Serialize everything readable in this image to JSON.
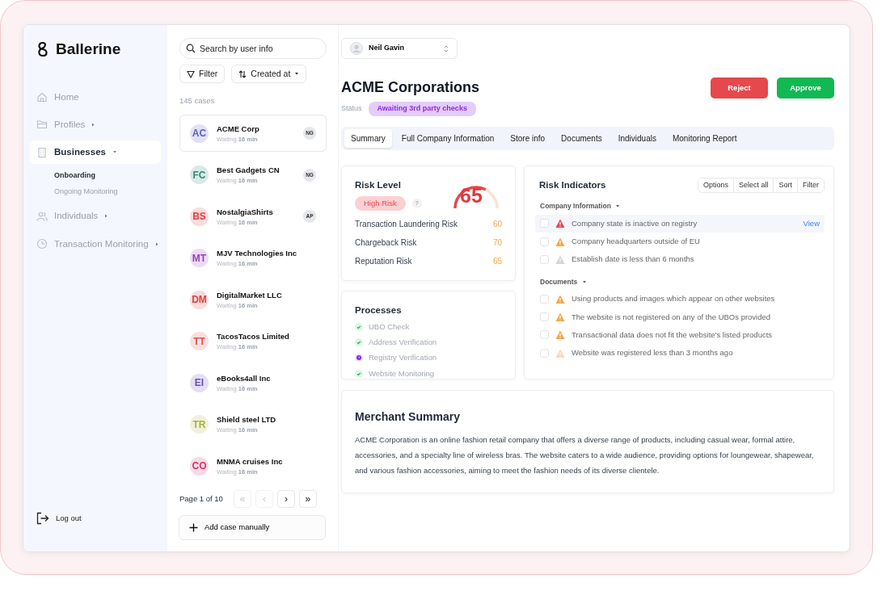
{
  "logo": {
    "text": "Ballerine"
  },
  "nav": [
    {
      "label": "Home",
      "kind": "link",
      "selected": false
    },
    {
      "label": "Profiles",
      "kind": "group",
      "selected": false,
      "expanded": false
    },
    {
      "label": "Businesses",
      "kind": "group",
      "selected": true,
      "expanded": true,
      "children": [
        {
          "label": "Onboarding",
          "selected": true
        },
        {
          "label": "Ongoing Monitoring",
          "selected": false
        }
      ]
    },
    {
      "label": "Individuals",
      "kind": "group",
      "selected": false,
      "expanded": false
    },
    {
      "label": "Transaction Monitoring",
      "kind": "group",
      "selected": false,
      "expanded": false
    }
  ],
  "logout": "Log out",
  "search": {
    "placeholder": "Search by user info"
  },
  "filter_button": "Filter",
  "sort_button": "Created at",
  "case_count": "145 cases",
  "cases": [
    {
      "initials": "AC",
      "color": "#5b5fc7",
      "name": "ACME Corp",
      "waiting": "Waiting",
      "time": "16 min",
      "assignee": "NG",
      "selected": true
    },
    {
      "initials": "FC",
      "color": "#2e8b72",
      "name": "Best Gadgets CN",
      "waiting": "Waiting",
      "time": "16 min",
      "assignee": "NG",
      "selected": false
    },
    {
      "initials": "BS",
      "color": "#e03e3e",
      "name": "NostalgiaShirts",
      "waiting": "Waiting",
      "time": "16 min",
      "assignee": "AP",
      "selected": false
    },
    {
      "initials": "MT",
      "color": "#9b3fc0",
      "name": "MJV Technologies Inc",
      "waiting": "Waiting",
      "time": "16 min",
      "selected": false
    },
    {
      "initials": "DM",
      "color": "#e03e3e",
      "name": "DigitalMarket LLC",
      "waiting": "Waiting",
      "time": "16 min",
      "selected": false
    },
    {
      "initials": "TT",
      "color": "#e05050",
      "name": "TacosTacos Limited",
      "waiting": "Waiting",
      "time": "16 min",
      "selected": false
    },
    {
      "initials": "EI",
      "color": "#6a4bc4",
      "name": "eBooks4all Inc",
      "waiting": "Waiting",
      "time": "16 min",
      "selected": false
    },
    {
      "initials": "TR",
      "color": "#a8b33a",
      "name": "Shield steel LTD",
      "waiting": "Waiting",
      "time": "16 min",
      "selected": false
    },
    {
      "initials": "CO",
      "color": "#d6336c",
      "name": "MNMA cruises Inc",
      "waiting": "Waiting",
      "time": "16 min",
      "selected": false
    }
  ],
  "pagination": {
    "label": "Page 1 of 10",
    "buttons": [
      {
        "label": "«",
        "disabled": true
      },
      {
        "label": "‹",
        "disabled": true
      },
      {
        "label": "›",
        "disabled": false
      },
      {
        "label": "»",
        "disabled": false
      }
    ]
  },
  "add_case": "Add case manually",
  "assignee": "Neil Gavin",
  "title": "ACME Corporations",
  "status_label": "Status",
  "status": "Awaiting 3rd party checks",
  "actions": [
    {
      "label": "Reject",
      "kind": "danger"
    },
    {
      "label": "Approve",
      "kind": "success"
    }
  ],
  "tabs": [
    {
      "label": "Summary",
      "selected": true
    },
    {
      "label": "Full Company Information",
      "selected": false
    },
    {
      "label": "Store info",
      "selected": false
    },
    {
      "label": "Documents",
      "selected": false
    },
    {
      "label": "Individuals",
      "selected": false
    },
    {
      "label": "Monitoring Report",
      "selected": false
    }
  ],
  "risk": {
    "title": "Risk Level",
    "badge": "High Risk",
    "help": "?",
    "score": "65",
    "rows": [
      {
        "label": "Transaction Laundering Risk",
        "value": "60"
      },
      {
        "label": "Chargeback Risk",
        "value": "70"
      },
      {
        "label": "Reputation Risk",
        "value": "65"
      }
    ]
  },
  "processes": {
    "title": "Processes",
    "items": [
      {
        "label": "UBO Check",
        "kind": "done"
      },
      {
        "label": "Address Verification",
        "kind": "done"
      },
      {
        "label": "Registry Verification",
        "kind": "pending"
      },
      {
        "label": "Website Monitoring",
        "kind": "done"
      }
    ]
  },
  "indicators": {
    "title": "Risk Indicators",
    "tools": [
      "Options",
      "Select all",
      "Sort",
      "Filter"
    ],
    "groups": [
      {
        "title": "Company Information",
        "expanded": true,
        "items": [
          {
            "text": "Company state is inactive on registry",
            "color": "#e5484d",
            "checked": false,
            "selected": true,
            "action": "View"
          },
          {
            "text": "Company headquarters outside of EU",
            "color": "#f5a54a",
            "checked": false,
            "selected": false
          },
          {
            "text": "Establish date is less than 6 months",
            "color": "#d4d4d8",
            "checked": false,
            "selected": false
          }
        ]
      },
      {
        "title": "Documents",
        "expanded": true,
        "items": [
          {
            "text": "Using products and images which appear on other websites",
            "color": "#f5a54a",
            "checked": false,
            "selected": false
          },
          {
            "text": "The website is not registered on any of the UBOs provided",
            "color": "#f5a54a",
            "checked": false,
            "selected": false
          },
          {
            "text": "Transactional data does not fit the website's listed products",
            "color": "#f5a54a",
            "checked": false,
            "selected": false
          },
          {
            "text": "Website was registered less than 3 months ago",
            "color": "#fbd9b3",
            "checked": false,
            "selected": false
          }
        ]
      }
    ]
  },
  "summary": {
    "title": "Merchant Summary",
    "text": "ACME Corporation is an online fashion retail company that offers a diverse range of products, including casual wear, formal attire, accessories, and a specialty line of wireless bras. The website caters to a wide audience, providing options for loungewear, shapewear, and various fashion accessories, aiming to meet the fashion needs of its diverse clientele."
  }
}
